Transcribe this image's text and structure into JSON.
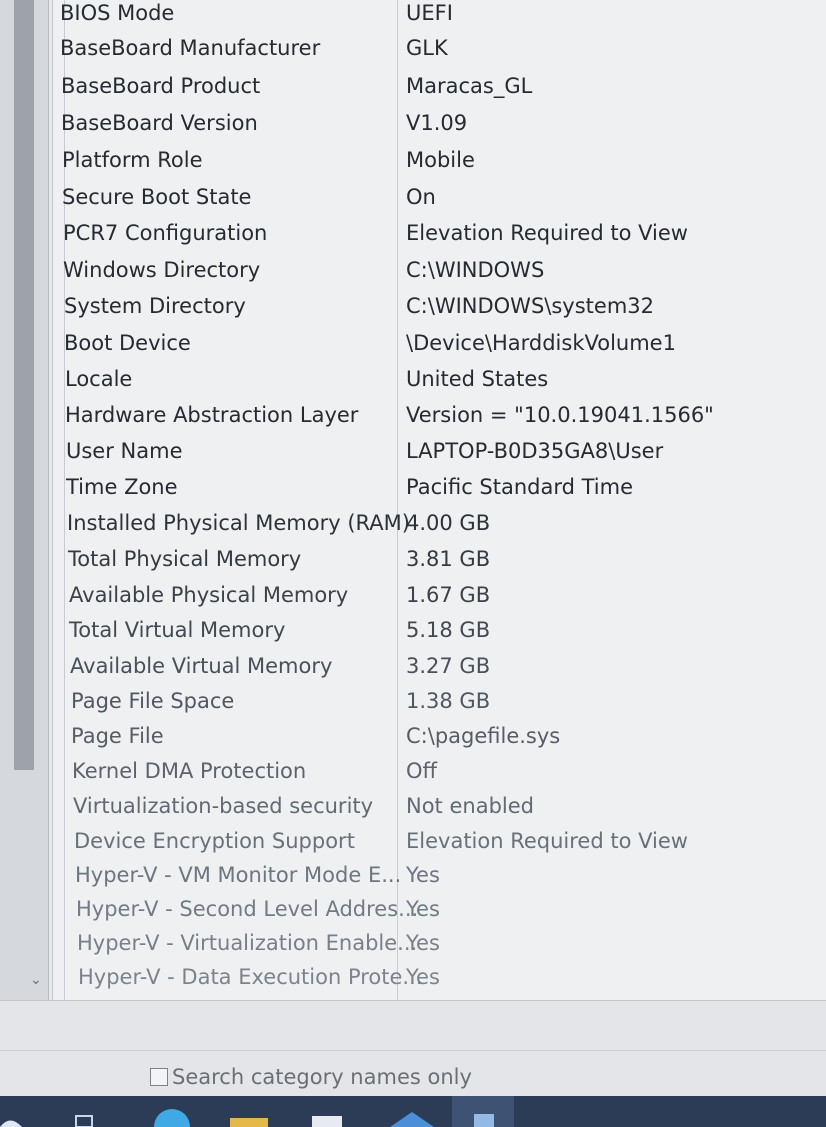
{
  "system_summary": {
    "rows": [
      {
        "item": "BIOS Mode",
        "value": "UEFI"
      },
      {
        "item": "BaseBoard Manufacturer",
        "value": "GLK"
      },
      {
        "item": "BaseBoard Product",
        "value": "Maracas_GL"
      },
      {
        "item": "BaseBoard Version",
        "value": "V1.09"
      },
      {
        "item": "Platform Role",
        "value": "Mobile"
      },
      {
        "item": "Secure Boot State",
        "value": "On"
      },
      {
        "item": "PCR7 Configuration",
        "value": "Elevation Required to View"
      },
      {
        "item": "Windows Directory",
        "value": "C:\\WINDOWS"
      },
      {
        "item": "System Directory",
        "value": "C:\\WINDOWS\\system32"
      },
      {
        "item": "Boot Device",
        "value": "\\Device\\HarddiskVolume1"
      },
      {
        "item": "Locale",
        "value": "United States"
      },
      {
        "item": "Hardware Abstraction Layer",
        "value": "Version = \"10.0.19041.1566\""
      },
      {
        "item": "User Name",
        "value": "LAPTOP-B0D35GA8\\User"
      },
      {
        "item": "Time Zone",
        "value": "Pacific Standard Time"
      },
      {
        "item": "Installed Physical Memory (RAM)",
        "value": "4.00 GB"
      },
      {
        "item": "Total Physical Memory",
        "value": "3.81 GB"
      },
      {
        "item": "Available Physical Memory",
        "value": "1.67 GB"
      },
      {
        "item": "Total Virtual Memory",
        "value": "5.18 GB"
      },
      {
        "item": "Available Virtual Memory",
        "value": "3.27 GB"
      },
      {
        "item": "Page File Space",
        "value": "1.38 GB"
      },
      {
        "item": "Page File",
        "value": "C:\\pagefile.sys"
      },
      {
        "item": "Kernel DMA Protection",
        "value": "Off"
      },
      {
        "item": "Virtualization-based security",
        "value": "Not enabled"
      },
      {
        "item": "Device Encryption Support",
        "value": "Elevation Required to View"
      },
      {
        "item": "Hyper-V - VM Monitor Mode E...",
        "value": "Yes"
      },
      {
        "item": "Hyper-V - Second Level Addres...",
        "value": "Yes"
      },
      {
        "item": "Hyper-V - Virtualization Enable...",
        "value": "Yes"
      },
      {
        "item": "Hyper-V - Data Execution Prote...",
        "value": "Yes"
      }
    ]
  },
  "search": {
    "checkbox_label": "Search category names only",
    "checked": false
  },
  "icons": {
    "scroll_down": "chevron-down-icon"
  },
  "colors": {
    "taskbar": "#2c3c57",
    "list_background": "#eef0f2"
  }
}
